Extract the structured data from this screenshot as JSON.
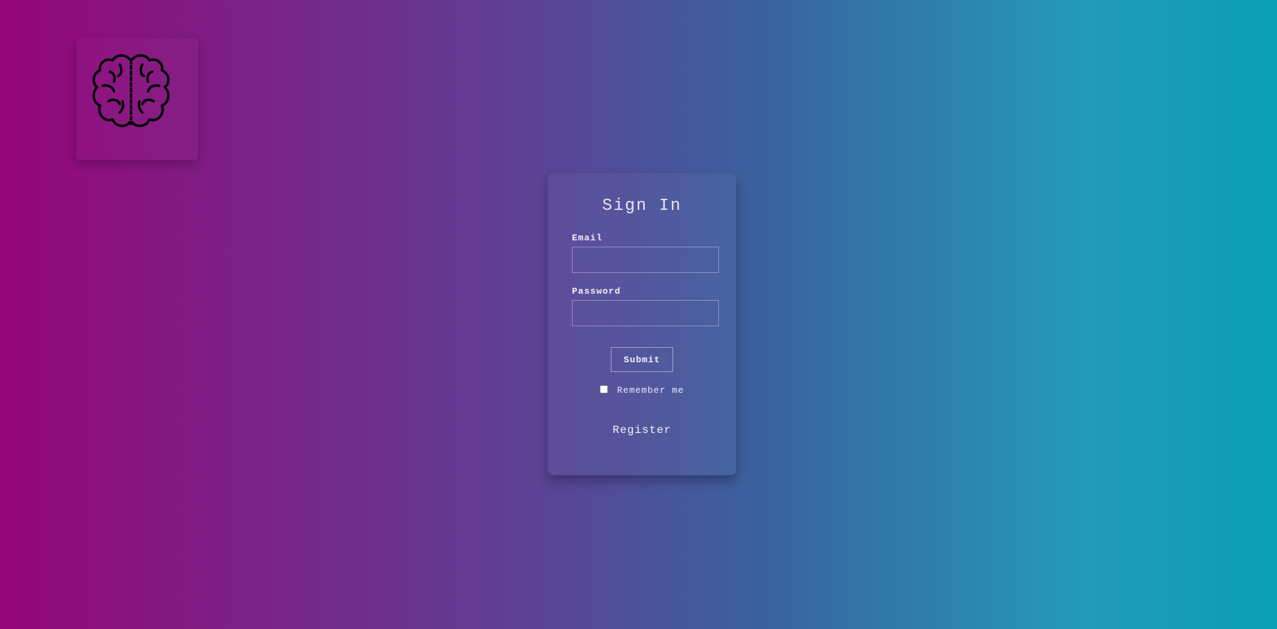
{
  "logo": {
    "icon": "brain-icon"
  },
  "signin": {
    "title": "Sign In",
    "email_label": "Email",
    "email_value": "",
    "password_label": "Password",
    "password_value": "",
    "submit_label": "Submit",
    "remember_label": "Remember me",
    "remember_checked": false,
    "register_label": "Register"
  },
  "colors": {
    "gradient_start": "#960579",
    "gradient_end": "#099eb2"
  }
}
